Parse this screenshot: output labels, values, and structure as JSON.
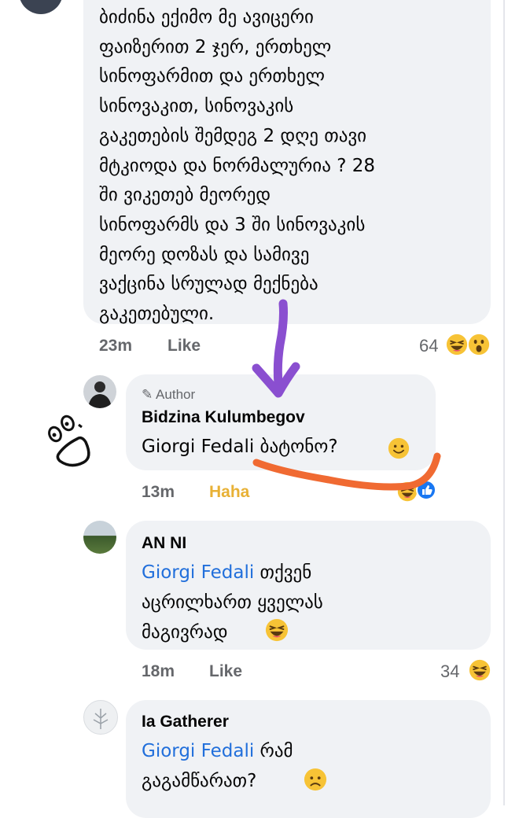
{
  "comment1": {
    "lines": [
      "ბიძინა ექიმო მე ავიცერი",
      "ფაიზერით 2 ჯერ, ერთხელ",
      "სინოფარმით და ერთხელ",
      "სინოვაკით, სინოვაკის",
      "გაკეთების შემდეგ 2 დღე თავი",
      "მტკიოდა და ნორმალურია ? 28",
      "ში ვიკეთებ მეორედ",
      "სინოფარმს და 3 ში სინოვაკის",
      "მეორე დოზას და სამივე",
      "ვაქცინა სრულად მექნება",
      "გაკეთებული."
    ],
    "time": "23m",
    "like": "Like",
    "reaction_count": "64",
    "reaction_icons": [
      "laugh-emoji",
      "wow-emoji"
    ]
  },
  "comment2": {
    "badge": "Author",
    "author": "Bidzina Kulumbegov",
    "mention": "Giorgi Fedali",
    "text": " ბატონო?",
    "time": "13m",
    "reaction": "Haha",
    "reaction_icons": [
      "laugh-emoji",
      "like-emoji"
    ]
  },
  "comment3": {
    "author": "AN NI",
    "mention": "Giorgi Fedali",
    "line1": " თქვენ",
    "line2": "აცრილხართ ყველას",
    "line3": "მაგივრად",
    "time": "18m",
    "like": "Like",
    "reaction_count": "34",
    "reaction_icons": [
      "laugh-emoji"
    ]
  },
  "comment4": {
    "author": "Ia Gatherer",
    "mention": "Giorgi Fedali",
    "line1": " რამ",
    "line2": "გაგამწარათ?"
  },
  "colors": {
    "bubble": "#f0f2f5",
    "mention": "#216fdb",
    "meta": "#65676b",
    "haha": "#e8b135",
    "purple_arrow": "#8a4fd0",
    "orange_underline": "#f06a32"
  }
}
